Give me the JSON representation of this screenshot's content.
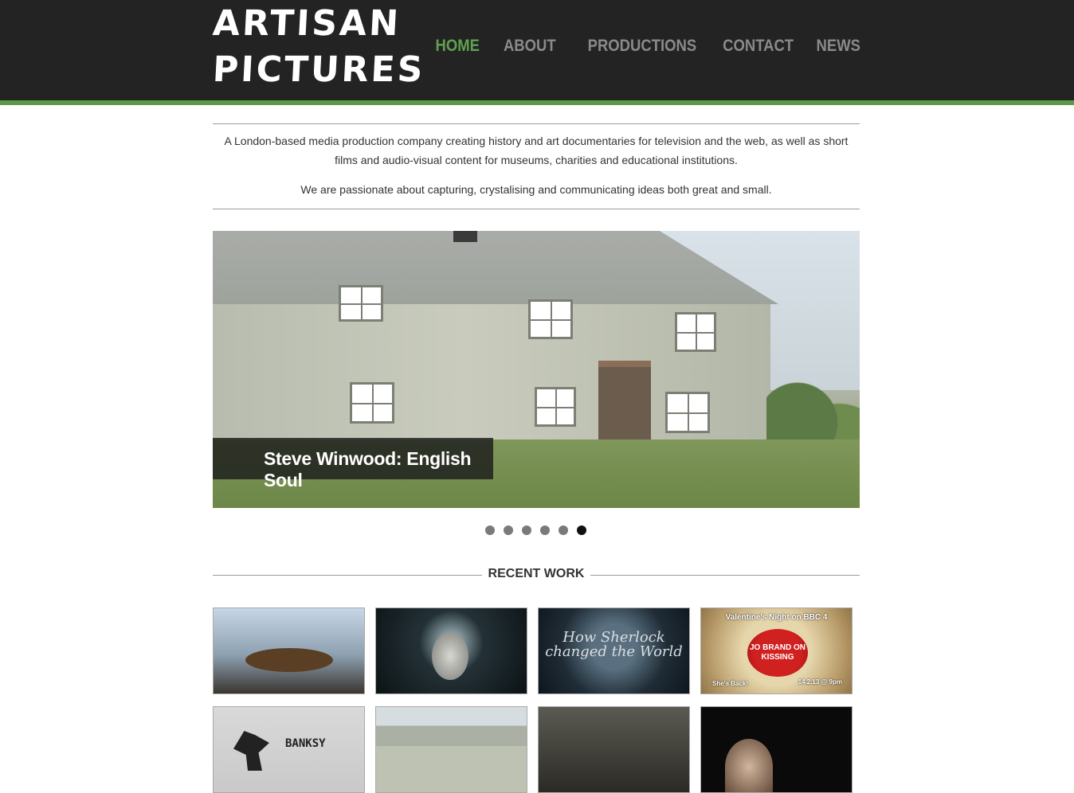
{
  "brand": {
    "line1": "ARTISAN",
    "line2": "PICTURES"
  },
  "nav": {
    "items": [
      {
        "label": "HOME",
        "active": true
      },
      {
        "label": "ABOUT",
        "active": false
      },
      {
        "label": "PRODUCTIONS",
        "active": false
      },
      {
        "label": "CONTACT",
        "active": false
      },
      {
        "label": "NEWS",
        "active": false
      }
    ]
  },
  "intro": {
    "p1": "A London-based media production company creating history and art documentaries for television and the web, as well as short films and audio-visual content for museums, charities and educational institutions.",
    "p2": "We are passionate about capturing, crystalising and communicating ideas both great and small."
  },
  "slider": {
    "caption": "Steve Winwood: English Soul",
    "slide_count": 6,
    "active_slide": 6
  },
  "recent_work": {
    "title": "RECENT WORK",
    "thumb3_text": "How Sherlock changed the World",
    "thumb4": {
      "top": "Valentine's Night on BBC 4",
      "center": "JO BRAND ON KISSING",
      "bottom_left": "She's Back!",
      "bottom_right": "14.2.13 @ 9pm"
    },
    "thumb5_text": "BANKSY"
  },
  "colors": {
    "header_bg": "#232323",
    "accent_green": "#5fa150",
    "nav_inactive": "#8a8a8a"
  }
}
